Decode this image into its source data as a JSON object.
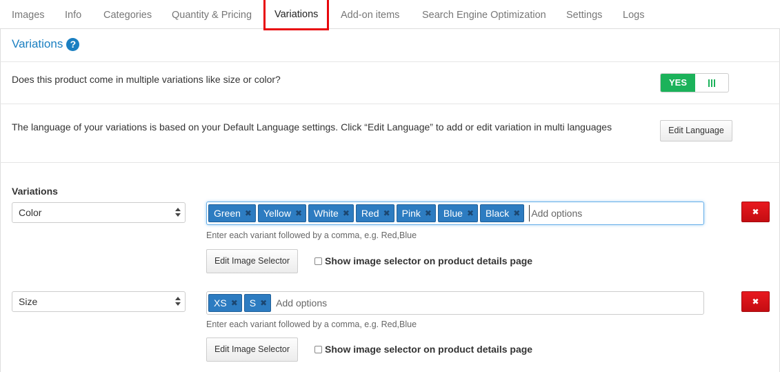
{
  "tabs": [
    {
      "label": "Images"
    },
    {
      "label": "Info"
    },
    {
      "label": "Categories"
    },
    {
      "label": "Quantity & Pricing"
    },
    {
      "label": "Variations"
    },
    {
      "label": "Add-on items"
    },
    {
      "label": "Search Engine Optimization"
    },
    {
      "label": "Settings"
    },
    {
      "label": "Logs"
    }
  ],
  "section": {
    "title": "Variations",
    "help_icon": "?"
  },
  "multi_variation": {
    "question": "Does this product come in multiple variations like size or color?",
    "toggle_label": "YES"
  },
  "language": {
    "text": "The language of your variations is based on your Default Language settings. Click “Edit Language” to add or edit variation in multi languages",
    "button_label": "Edit Language"
  },
  "variations": {
    "heading": "Variations",
    "rows": [
      {
        "type": "Color",
        "options": [
          "Green",
          "Yellow",
          "White",
          "Red",
          "Pink",
          "Blue",
          "Black"
        ],
        "placeholder": "Add options",
        "hint": "Enter each variant followed by a comma, e.g. Red,Blue",
        "image_selector_label": "Edit Image Selector",
        "checkbox_label": "Show image selector on product details page",
        "delete_label": "✖"
      },
      {
        "type": "Size",
        "options": [
          "XS",
          "S"
        ],
        "placeholder": "Add options",
        "hint": "Enter each variant followed by a comma, e.g. Red,Blue",
        "image_selector_label": "Edit Image Selector",
        "checkbox_label": "Show image selector on product details page",
        "delete_label": "✖"
      }
    ]
  },
  "colors": {
    "accent": "#1a7fc1",
    "toggle_on": "#1bb25a",
    "tag_bg": "#2d7cc1",
    "delete": "#d9121a",
    "active_tab_outline": "#e8060b"
  }
}
